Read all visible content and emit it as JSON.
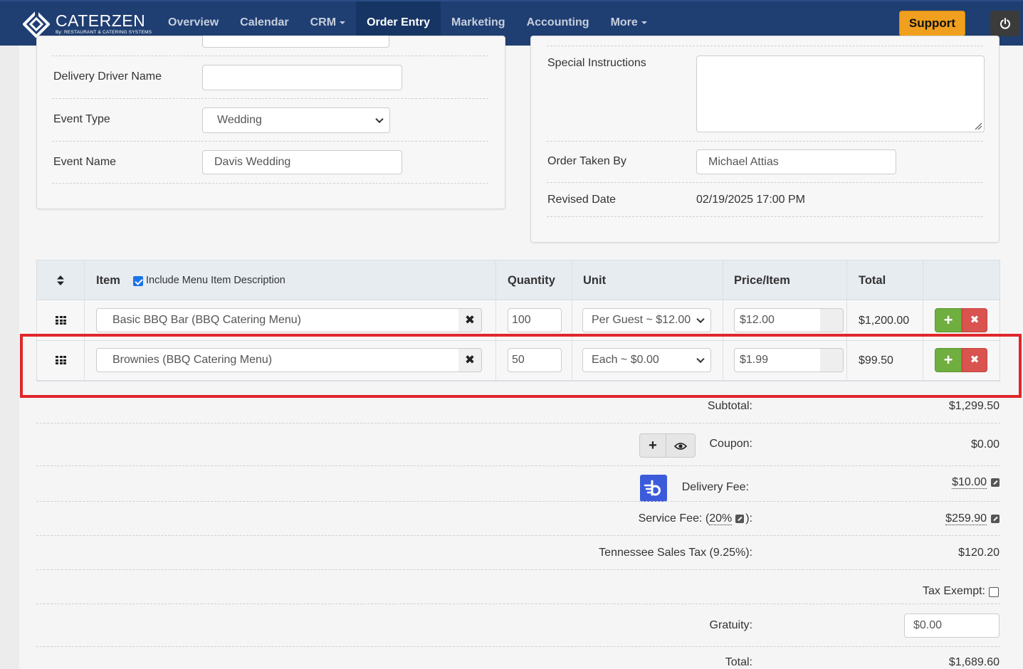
{
  "app": {
    "brand_name": "CATERZEN",
    "brand_sub": "By: RESTAURANT & CATERING SYSTEMS"
  },
  "nav": {
    "items": [
      {
        "label": "Overview",
        "active": false,
        "dropdown": false
      },
      {
        "label": "Calendar",
        "active": false,
        "dropdown": false
      },
      {
        "label": "CRM",
        "active": false,
        "dropdown": true
      },
      {
        "label": "Order Entry",
        "active": true,
        "dropdown": false
      },
      {
        "label": "Marketing",
        "active": false,
        "dropdown": false
      },
      {
        "label": "Accounting",
        "active": false,
        "dropdown": false
      },
      {
        "label": "More",
        "active": false,
        "dropdown": true
      }
    ],
    "support_label": "Support",
    "power_icon": "power-icon"
  },
  "left_form": {
    "driver_label": "Delivery Driver Name",
    "driver_value": "",
    "event_type_label": "Event Type",
    "event_type_value": "Wedding",
    "event_name_label": "Event Name",
    "event_name_value": "Davis Wedding"
  },
  "right_form": {
    "special_label": "Special Instructions",
    "special_value": "",
    "taken_by_label": "Order Taken By",
    "taken_by_value": "Michael Attias",
    "revised_label": "Revised Date",
    "revised_value": "02/19/2025 17:00 PM"
  },
  "items_table": {
    "headers": {
      "item": "Item",
      "include_desc": "Include Menu Item Description",
      "quantity": "Quantity",
      "unit": "Unit",
      "price": "Price/Item",
      "total": "Total"
    },
    "include_desc_checked": true,
    "rows": [
      {
        "item": "Basic BBQ Bar (BBQ Catering Menu)",
        "quantity": "100",
        "unit": "Per Guest ~ $12.00",
        "price": "$12.00",
        "total": "$1,200.00"
      },
      {
        "item": "Brownies (BBQ Catering Menu)",
        "quantity": "50",
        "unit": "Each ~ $0.00",
        "price": "$1.99",
        "total": "$99.50"
      }
    ]
  },
  "totals": {
    "subtotal_label": "Subtotal:",
    "subtotal_value": "$1,299.50",
    "coupon_label": "Coupon:",
    "coupon_value": "$0.00",
    "delivery_label": "Delivery Fee:",
    "delivery_value": "$10.00",
    "service_label_pre": "Service Fee: (",
    "service_pct": "20%",
    "service_label_post": "):",
    "service_value": "$259.90",
    "tax_label": "Tennessee Sales Tax (9.25%):",
    "tax_value": "$120.20",
    "tax_exempt_label": "Tax Exempt:",
    "tax_exempt_checked": false,
    "gratuity_label": "Gratuity:",
    "gratuity_value": "$0.00",
    "total_label": "Total:",
    "total_value": "$1,689.60"
  },
  "colors": {
    "nav_bg": "#1f3e72",
    "support": "#f0a01e",
    "add": "#6fae3f",
    "delete": "#d9534f",
    "highlight": "#e0262b",
    "delivery_badge": "#3b5bdb"
  }
}
